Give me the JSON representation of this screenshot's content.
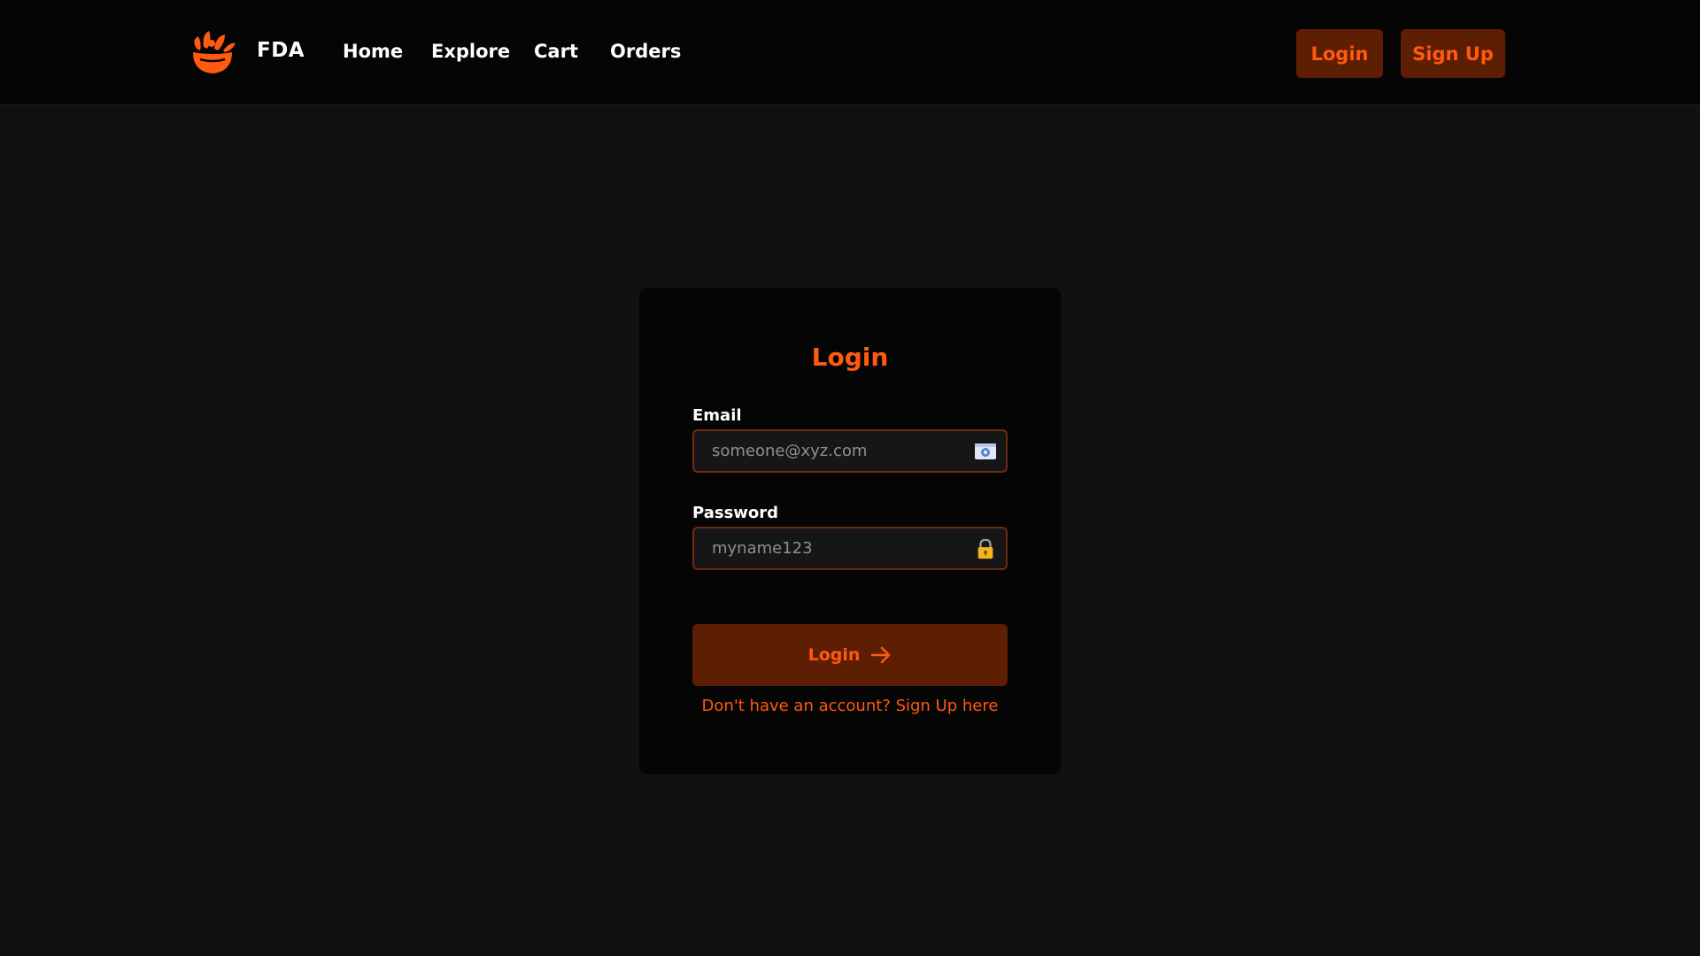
{
  "navbar": {
    "brand": "FDA",
    "logo_icon": "salad-bowl-icon",
    "links": [
      "Home",
      "Explore",
      "Cart",
      "Orders"
    ],
    "login_label": "Login",
    "signup_label": "Sign Up"
  },
  "login_form": {
    "title": "Login",
    "email": {
      "label": "Email",
      "placeholder": "someone@xyz.com",
      "value": "",
      "icon": "email-card-icon"
    },
    "password": {
      "label": "Password",
      "placeholder": "myname123",
      "value": "",
      "icon": "lock-icon"
    },
    "submit_label": "Login",
    "submit_icon": "arrow-right-icon",
    "signup_prompt": "Don't have an account? Sign Up here"
  },
  "colors": {
    "background": "#111111",
    "navbar": "#050505",
    "card": "#050505",
    "accent": "#ff5a10",
    "button_bg": "#5e1e03",
    "input_border": "#6e2a10"
  }
}
